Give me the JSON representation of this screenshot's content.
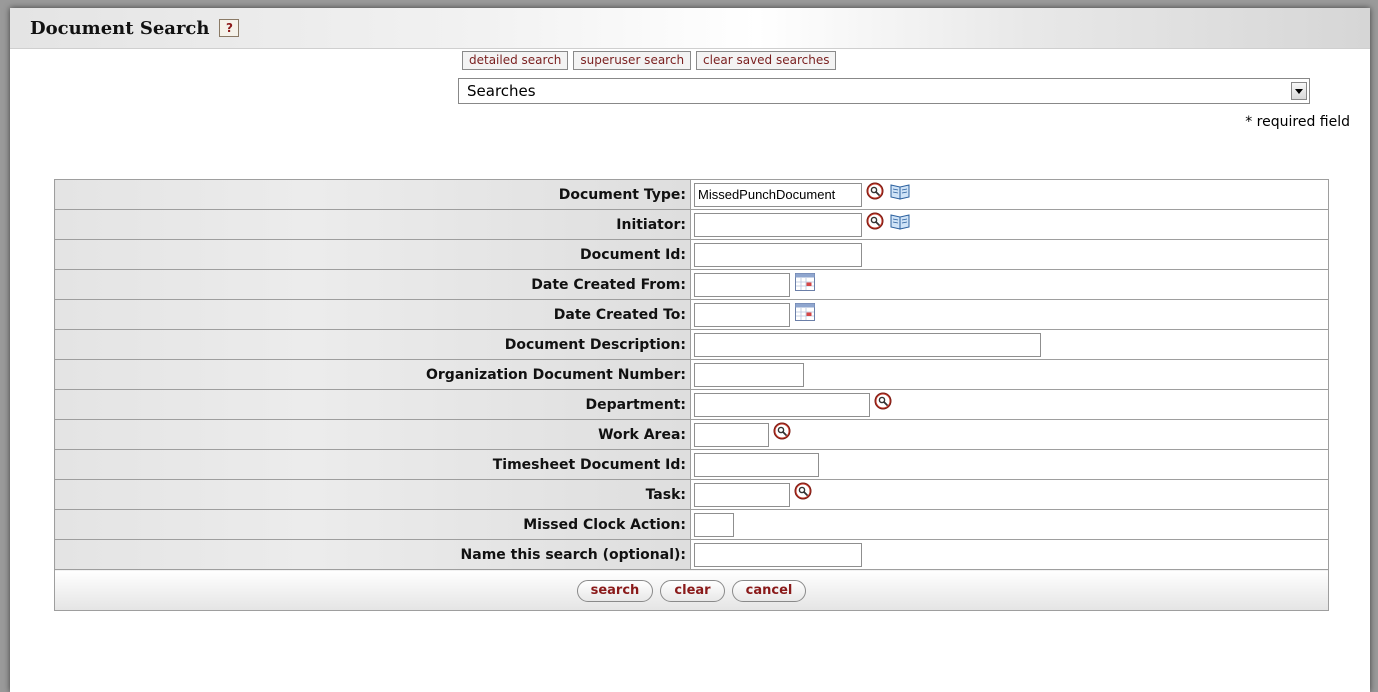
{
  "header": {
    "title": "Document Search",
    "help_label": "?"
  },
  "toolbar": {
    "detailed_search": "detailed search",
    "superuser_search": "superuser search",
    "clear_saved_searches": "clear saved searches"
  },
  "saved_searches": {
    "selected": "Searches"
  },
  "required_note": "* required field",
  "form": {
    "document_type": {
      "label": "Document Type:",
      "value": "MissedPunchDocument"
    },
    "initiator": {
      "label": "Initiator:",
      "value": ""
    },
    "document_id": {
      "label": "Document Id:",
      "value": ""
    },
    "date_created_from": {
      "label": "Date Created From:",
      "value": ""
    },
    "date_created_to": {
      "label": "Date Created To:",
      "value": ""
    },
    "document_description": {
      "label": "Document Description:",
      "value": ""
    },
    "organization_document_number": {
      "label": "Organization Document Number:",
      "value": ""
    },
    "department": {
      "label": "Department:",
      "value": ""
    },
    "work_area": {
      "label": "Work Area:",
      "value": ""
    },
    "timesheet_document_id": {
      "label": "Timesheet Document Id:",
      "value": ""
    },
    "task": {
      "label": "Task:",
      "value": ""
    },
    "missed_clock_action": {
      "label": "Missed Clock Action:",
      "value": ""
    },
    "search_name": {
      "label": "Name this search (optional):",
      "value": ""
    }
  },
  "buttons": {
    "search": "search",
    "clear": "clear",
    "cancel": "cancel"
  }
}
